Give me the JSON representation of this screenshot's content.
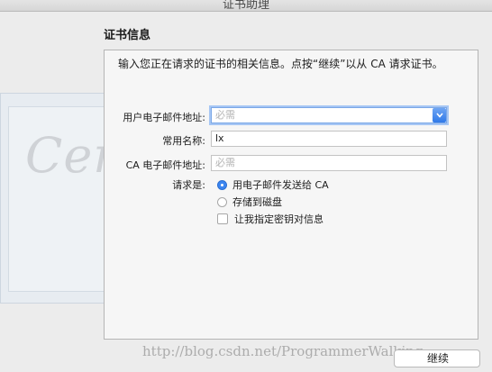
{
  "window": {
    "title": "证书助理"
  },
  "section": {
    "title": "证书信息"
  },
  "intro": "输入您正在请求的证书的相关信息。点按“继续”以从 CA 请求证书。",
  "background": {
    "cert_word": "Certificate"
  },
  "form": {
    "email": {
      "label": "用户电子邮件地址:",
      "placeholder": "必需",
      "value": ""
    },
    "common_name": {
      "label": "常用名称:",
      "value": "lx"
    },
    "ca_email": {
      "label": "CA 电子邮件地址:",
      "placeholder": "必需",
      "value": ""
    },
    "request": {
      "label": "请求是:",
      "options": [
        {
          "label": "用电子邮件发送给 CA",
          "selected": true
        },
        {
          "label": "存储到磁盘",
          "selected": false
        }
      ],
      "checkbox": {
        "label": "让我指定密钥对信息",
        "checked": false
      }
    }
  },
  "watermark": "http://blog.csdn.net/ProgrammerWalking",
  "buttons": {
    "continue": "继续"
  },
  "colors": {
    "accent": "#3b85f0",
    "focus_ring": "#a6c6f4"
  }
}
